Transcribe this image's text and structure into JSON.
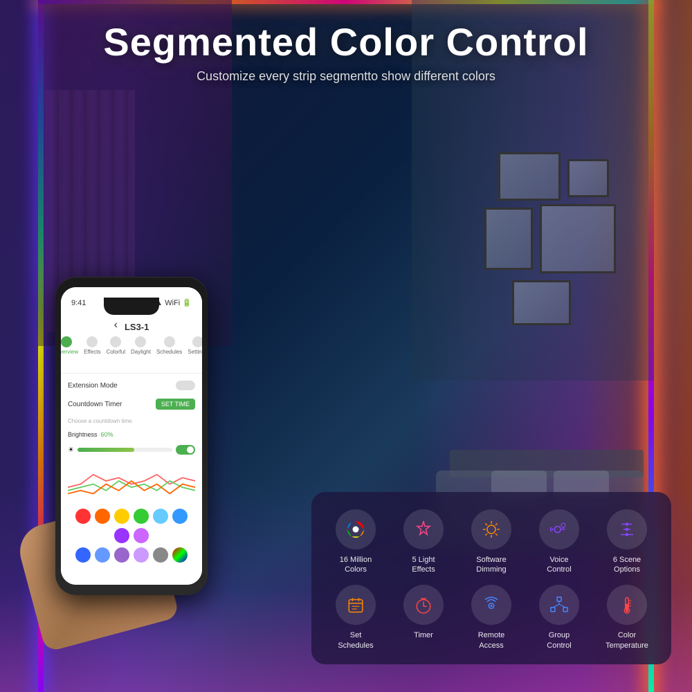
{
  "page": {
    "title": "Segmented Color Control",
    "subtitle": "Customize every strip segmentto show different colors"
  },
  "phone": {
    "time": "9:41",
    "device_name": "LS3-1",
    "tabs": [
      {
        "label": "Overview",
        "active": true
      },
      {
        "label": "Effects",
        "active": false
      },
      {
        "label": "Colorful",
        "active": false
      },
      {
        "label": "Daylight",
        "active": false
      },
      {
        "label": "Schedules",
        "active": false
      },
      {
        "label": "Settings",
        "active": false
      }
    ],
    "extension_mode_label": "Extension Mode",
    "countdown_label": "Countdown Timer",
    "set_time_btn": "SET TIME",
    "choose_hint": "Choose a countdown time.",
    "brightness_label": "Brightness",
    "brightness_value": "60%",
    "colors": [
      "#ff3333",
      "#ff6600",
      "#ffcc00",
      "#33cc33",
      "#66ccff",
      "#3399ff",
      "#9933ff",
      "#cc66ff",
      "#cccccc",
      "#ffffff"
    ]
  },
  "features": [
    {
      "icon": "🎨",
      "label": "16 Million\nColors",
      "icon_type": "color-wheel"
    },
    {
      "icon": "⭐",
      "label": "5 Light\nEffects",
      "icon_type": "star"
    },
    {
      "icon": "☀",
      "label": "Software\nDimming",
      "icon_type": "sun"
    },
    {
      "icon": "🎙",
      "label": "Voice\nControl",
      "icon_type": "voice"
    },
    {
      "icon": "🎛",
      "label": "6 Scene\nOptions",
      "icon_type": "sliders"
    },
    {
      "icon": "📅",
      "label": "Set\nSchedules",
      "icon_type": "calendar"
    },
    {
      "icon": "⏱",
      "label": "Timer",
      "icon_type": "timer"
    },
    {
      "icon": "📡",
      "label": "Remote\nAccess",
      "icon_type": "remote"
    },
    {
      "icon": "🔗",
      "label": "Group\nControl",
      "icon_type": "group"
    },
    {
      "icon": "🌡",
      "label": "Color\nTemperature",
      "icon_type": "thermometer"
    }
  ]
}
